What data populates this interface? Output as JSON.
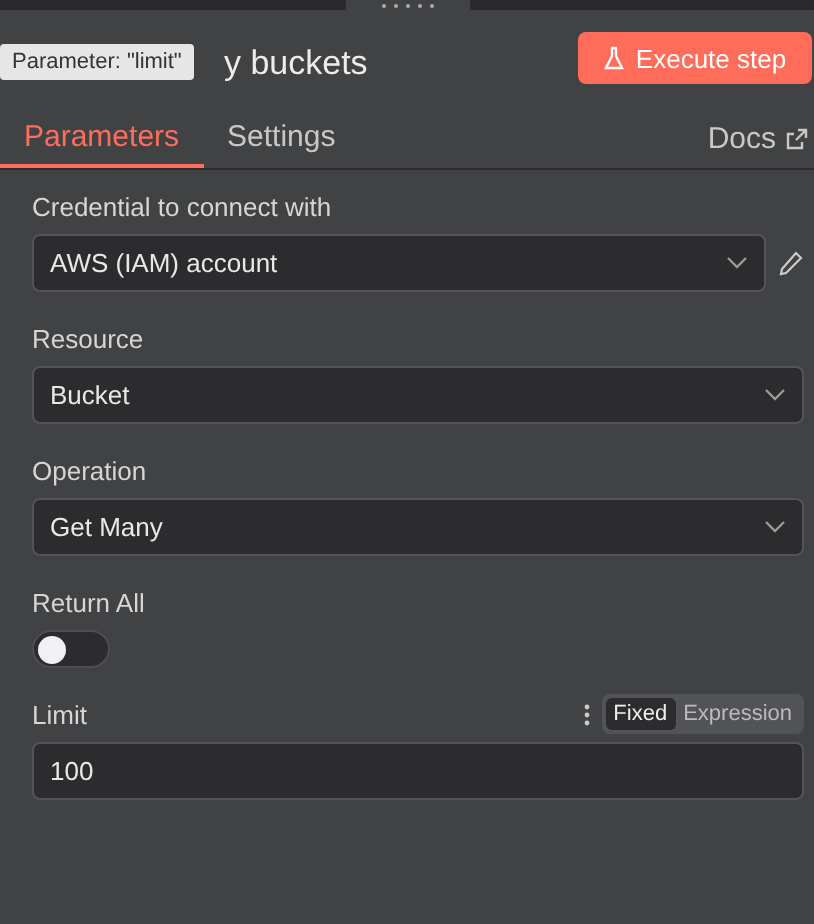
{
  "tooltip": "Parameter: \"limit\"",
  "title": "y buckets",
  "execute_button": "Execute step",
  "tabs": [
    {
      "label": "Parameters",
      "selected": true
    },
    {
      "label": "Settings",
      "selected": false
    }
  ],
  "docs_link": "Docs",
  "fields": [
    {
      "kind": "select",
      "label": "Credential to connect with",
      "value": "AWS (IAM) account",
      "editable": true
    },
    {
      "kind": "select",
      "label": "Resource",
      "value": "Bucket",
      "editable": false
    },
    {
      "kind": "select",
      "label": "Operation",
      "value": "Get Many",
      "editable": false
    },
    {
      "kind": "toggle",
      "label": "Return All",
      "on": false
    },
    {
      "kind": "input",
      "label": "Limit",
      "value": "100",
      "mode_options": [
        {
          "label": "Fixed",
          "selected": true
        },
        {
          "label": "Expression",
          "selected": false
        }
      ]
    }
  ]
}
